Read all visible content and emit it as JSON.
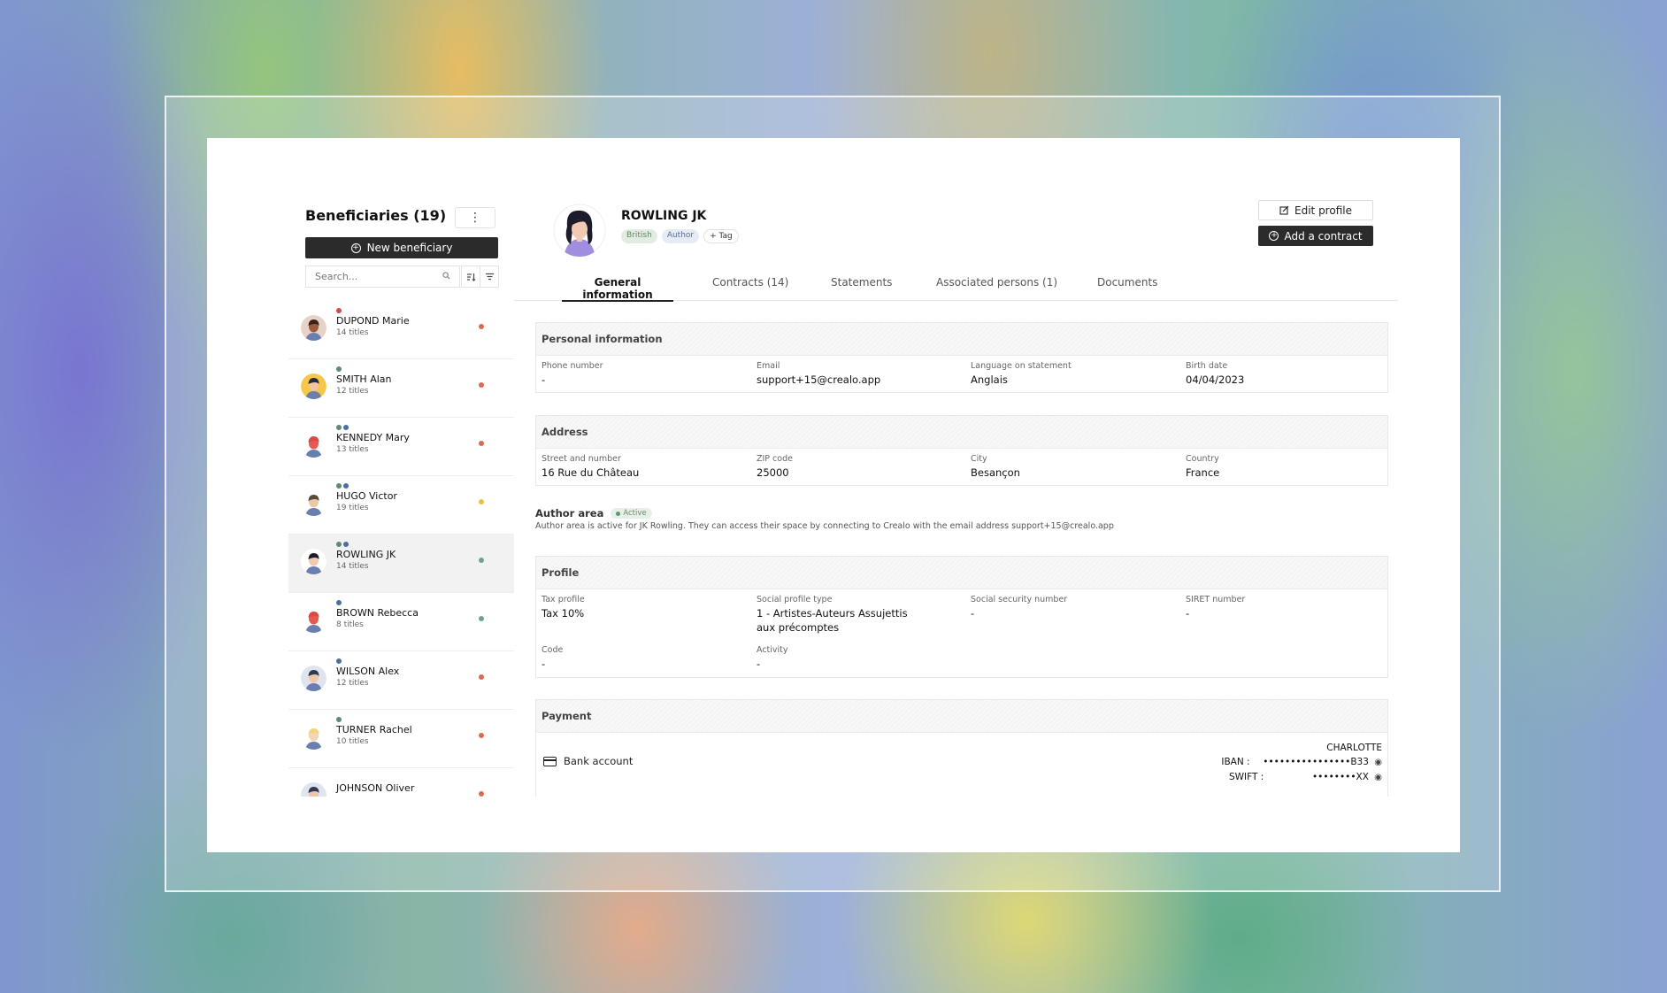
{
  "sidebar": {
    "title": "Beneficiaries (19)",
    "kebab_icon": "⋮",
    "new_button": "New beneficiary",
    "search_placeholder": "Search...",
    "items": [
      {
        "name": "DUPOND Marie",
        "titles": "14 titles",
        "tags": [
          "#d04a4a"
        ],
        "status": "#d96b4f",
        "avatar_bg": "#e6d2c6",
        "skin": "#9c5b3e",
        "hair": "#3b2318"
      },
      {
        "name": "SMITH Alan",
        "titles": "12 titles",
        "tags": [
          "#5e8a7a"
        ],
        "status": "#d96b4f",
        "avatar_bg": "#f5c84a",
        "skin": "#f0c6a4",
        "hair": "#2b2b3a"
      },
      {
        "name": "KENNEDY Mary",
        "titles": "13 titles",
        "tags": [
          "#5e8a7a",
          "#4a6fa5"
        ],
        "status": "#d96b4f",
        "avatar_bg": "#ffffff",
        "skin": "#e85a4f",
        "hair": "#d94a47"
      },
      {
        "name": "HUGO Victor",
        "titles": "19 titles",
        "tags": [
          "#5e8a7a",
          "#4a6fa5"
        ],
        "status": "#e8c23a",
        "avatar_bg": "#ffffff",
        "skin": "#e9c9a6",
        "hair": "#5a4a3a"
      },
      {
        "name": "ROWLING JK",
        "titles": "14 titles",
        "tags": [
          "#5e8a7a",
          "#4a6fa5"
        ],
        "status": "#6fa38f",
        "avatar_bg": "#ffffff",
        "skin": "#f2c9b2",
        "hair": "#1c1c2a",
        "selected": true
      },
      {
        "name": "BROWN Rebecca",
        "titles": "8 titles",
        "tags": [
          "#4a6fa5"
        ],
        "status": "#6fa38f",
        "avatar_bg": "#ffffff",
        "skin": "#e85a4f",
        "hair": "#d94a47"
      },
      {
        "name": "WILSON Alex",
        "titles": "12 titles",
        "tags": [
          "#4a6fa5"
        ],
        "status": "#d96b4f",
        "avatar_bg": "#dfe4ee",
        "skin": "#f0c6a4",
        "hair": "#2f3a52"
      },
      {
        "name": "TURNER Rachel",
        "titles": "10 titles",
        "tags": [
          "#5e8a7a"
        ],
        "status": "#d96b4f",
        "avatar_bg": "#ffffff",
        "skin": "#f3d4b5",
        "hair": "#f0d580"
      },
      {
        "name": "JOHNSON Oliver",
        "titles": "",
        "tags": [],
        "status": "#d96b4f",
        "avatar_bg": "#dfe4ee",
        "skin": "#f0c6a4",
        "hair": "#2f3a52"
      }
    ]
  },
  "profile": {
    "name": "ROWLING JK",
    "chips": {
      "nationality": "British",
      "role": "Author",
      "add_tag": "+ Tag"
    },
    "edit_button": "Edit profile",
    "add_contract_button": "Add a contract"
  },
  "tabs": [
    "General information",
    "Contracts (14)",
    "Statements",
    "Associated persons (1)",
    "Documents"
  ],
  "personal": {
    "title": "Personal information",
    "phone_label": "Phone number",
    "phone": "-",
    "email_label": "Email",
    "email": "support+15@crealo.app",
    "language_label": "Language on statement",
    "language": "Anglais",
    "birth_label": "Birth date",
    "birth": "04/04/2023"
  },
  "address": {
    "title": "Address",
    "street_label": "Street and number",
    "street": "16 Rue du Château",
    "zip_label": "ZIP code",
    "zip": "25000",
    "city_label": "City",
    "city": "Besançon",
    "country_label": "Country",
    "country": "France"
  },
  "author_area": {
    "title": "Author area",
    "badge": "Active",
    "description": "Author area is active for JK Rowling. They can access their space by connecting to Crealo with the email address support+15@crealo.app"
  },
  "profile_section": {
    "title": "Profile",
    "tax_label": "Tax profile",
    "tax": "Tax 10%",
    "social_type_label": "Social profile type",
    "social_type_1": "1 - Artistes-Auteurs Assujettis",
    "social_type_2": "aux précomptes",
    "ssn_label": "Social security number",
    "ssn": "-",
    "siret_label": "SIRET number",
    "siret": "-",
    "code_label": "Code",
    "code": "-",
    "activity_label": "Activity",
    "activity": "-"
  },
  "payment": {
    "title": "Payment",
    "bank_label": "Bank account",
    "holder": "CHARLOTTE",
    "iban_label": "IBAN :",
    "iban": "••••••••••••••••B33",
    "swift_label": "SWIFT :",
    "swift": "••••••••XX",
    "eye_icon": "◉"
  }
}
